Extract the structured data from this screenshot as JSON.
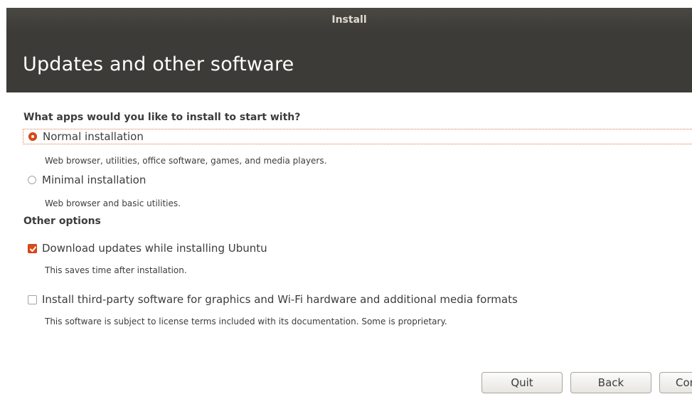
{
  "window": {
    "title": "Install"
  },
  "header": {
    "title": "Updates and other software"
  },
  "apps_section": {
    "question": "What apps would you like to install to start with?",
    "options": [
      {
        "label": "Normal installation",
        "description": "Web browser, utilities, office software, games, and media players.",
        "selected": true
      },
      {
        "label": "Minimal installation",
        "description": "Web browser and basic utilities.",
        "selected": false
      }
    ]
  },
  "other_options": {
    "title": "Other options",
    "items": [
      {
        "label": "Download updates while installing Ubuntu",
        "description": "This saves time after installation.",
        "checked": true
      },
      {
        "label": "Install third-party software for graphics and Wi-Fi hardware and additional media formats",
        "description": "This software is subject to license terms included with its documentation. Some is proprietary.",
        "checked": false
      }
    ]
  },
  "buttons": {
    "quit": "Quit",
    "back": "Back",
    "continue": "Continue"
  },
  "colors": {
    "accent": "#df4a16",
    "header_bg": "#3c3b37",
    "titlebar_text": "#dfdbd2"
  }
}
